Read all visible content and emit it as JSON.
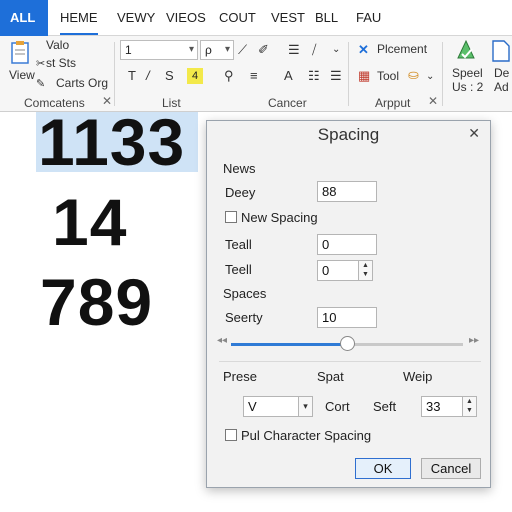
{
  "tabs": [
    "ALL",
    "HEME",
    "VEWY",
    "VIEOS",
    "COUT",
    "VEST",
    "BLL",
    "FAU"
  ],
  "ribbon": {
    "group1": {
      "label": "Comcatens",
      "view_label": "View",
      "item1": "Valo",
      "item2": "st Sts",
      "item3": "Carts Org"
    },
    "group2": {
      "label": "List",
      "font_value": "1",
      "size_value": "ρ",
      "highlight_value": "4"
    },
    "group3": {
      "label": "Cancer"
    },
    "group4": {
      "label": "Arpput",
      "placement_label": "Plcement",
      "tool_label": "Tool"
    },
    "group5": {
      "speed_label1": "Speel",
      "speed_label2": "Us : 2",
      "add_label1": "De",
      "add_label2": "Ad"
    }
  },
  "document": {
    "line1": "1133",
    "line2": "14",
    "line3": "789"
  },
  "dialog": {
    "title": "Spacing",
    "section_news": "News",
    "deey_label": "Deey",
    "deey_value": "88",
    "new_spacing_label": "New Spacing",
    "teall1_label": "Teall",
    "teall1_value": "0",
    "teall2_label": "Teell",
    "teall2_value": "0",
    "section_spaces": "Spaces",
    "seerty_label": "Seerty",
    "seerty_value": "10",
    "slider_level": 0.5,
    "prese_label": "Prese",
    "spat_label": "Spat",
    "weip_label": "Weip",
    "select_value": "V",
    "cort_label": "Cort",
    "seft_label": "Seft",
    "seft_value": "33",
    "pul_label": "Pul Character Spacing",
    "ok_label": "OK",
    "cancel_label": "Cancel"
  },
  "colors": {
    "accent": "#1e6fd9",
    "selection": "#cfe3f6",
    "highlight": "#f3e94a"
  }
}
